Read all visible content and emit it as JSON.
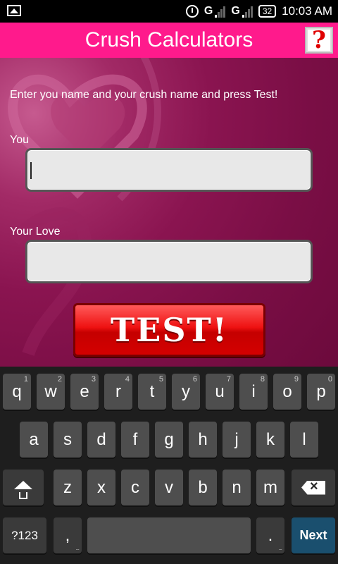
{
  "status_bar": {
    "time": "10:03 AM",
    "battery": "32",
    "sim1": "G",
    "sim2": "G"
  },
  "title_bar": {
    "title": "Crush Calculators",
    "help_label": "?"
  },
  "form": {
    "instruction": "Enter you name and your crush name and press Test!",
    "you_label": "You",
    "you_value": "",
    "love_label": "Your Love",
    "love_value": "",
    "test_label": "TEST!"
  },
  "keyboard": {
    "row1": [
      {
        "k": "q",
        "h": "1"
      },
      {
        "k": "w",
        "h": "2"
      },
      {
        "k": "e",
        "h": "3"
      },
      {
        "k": "r",
        "h": "4"
      },
      {
        "k": "t",
        "h": "5"
      },
      {
        "k": "y",
        "h": "6"
      },
      {
        "k": "u",
        "h": "7"
      },
      {
        "k": "i",
        "h": "8"
      },
      {
        "k": "o",
        "h": "9"
      },
      {
        "k": "p",
        "h": "0"
      }
    ],
    "row2": [
      "a",
      "s",
      "d",
      "f",
      "g",
      "h",
      "j",
      "k",
      "l"
    ],
    "row3": [
      "z",
      "x",
      "c",
      "v",
      "b",
      "n",
      "m"
    ],
    "sym_label": "?123",
    "comma_label": ",",
    "period_label": ".",
    "next_label": "Next"
  },
  "colors": {
    "accent": "#ff1a8c",
    "background": "#7a0e45",
    "test_button": "#ee1111"
  }
}
